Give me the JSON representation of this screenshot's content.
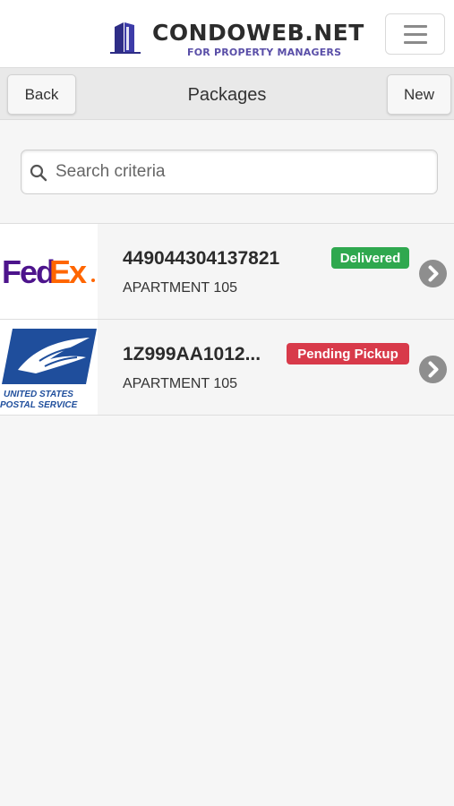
{
  "header": {
    "brand_title": "CONDOWEB.NET",
    "brand_subtitle": "FOR PROPERTY MANAGERS",
    "menu_icon": "hamburger-icon",
    "brand_color": "#5a4fa8"
  },
  "nav": {
    "back_label": "Back",
    "title": "Packages",
    "new_label": "New"
  },
  "search": {
    "placeholder": "Search criteria",
    "value": "",
    "icon": "search-icon"
  },
  "packages": [
    {
      "carrier": "FedEx",
      "tracking": "449044304137821",
      "unit": "APARTMENT 105",
      "status": "Delivered",
      "status_color": "#2fa84f"
    },
    {
      "carrier": "United States Postal Service",
      "carrier_logo_line1": "UNITED STATES",
      "carrier_logo_line2": "POSTAL SERVICE",
      "tracking": "1Z999AA1012...",
      "unit": "APARTMENT 105",
      "status": "Pending Pickup",
      "status_color": "#d83a4a"
    }
  ]
}
